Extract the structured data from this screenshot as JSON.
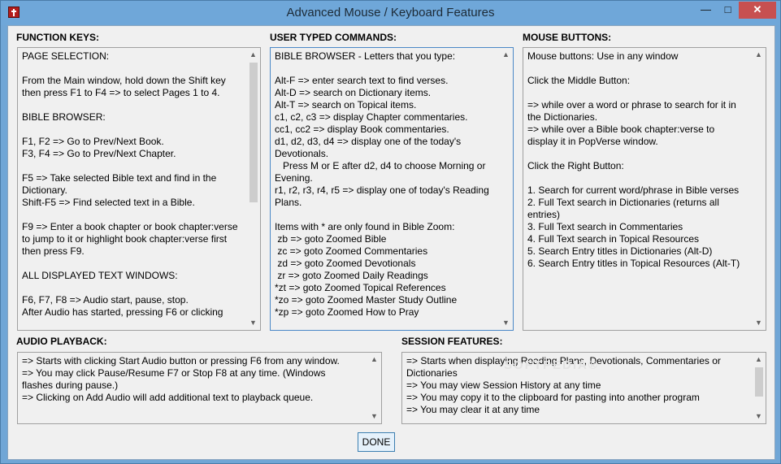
{
  "window": {
    "title": "Advanced Mouse / Keyboard Features",
    "minimize_glyph": "—",
    "maximize_glyph": "□",
    "close_glyph": "✕"
  },
  "sections": {
    "function_keys": {
      "label": "FUNCTION KEYS:",
      "text": "PAGE SELECTION:\n\nFrom the Main window, hold down the Shift key\nthen press F1 to F4 => to select Pages 1 to 4.\n\nBIBLE BROWSER:\n\nF1, F2 => Go to Prev/Next Book.\nF3, F4 => Go to Prev/Next Chapter.\n\nF5 => Take selected Bible text and find in the\nDictionary.\nShift-F5 => Find selected text in a Bible.\n\nF9 => Enter a book chapter or book chapter:verse\nto jump to it or highlight book chapter:verse first\nthen press F9.\n\nALL DISPLAYED TEXT WINDOWS:\n\nF6, F7, F8 => Audio start, pause, stop.\nAfter Audio has started, pressing F6 or clicking"
    },
    "user_typed_commands": {
      "label": "USER TYPED COMMANDS:",
      "text": "BIBLE BROWSER - Letters that you type:\n\nAlt-F => enter search text to find verses.\nAlt-D => search on Dictionary items.\nAlt-T => search on Topical items.\nc1, c2, c3 => display Chapter commentaries.\ncc1, cc2 => display Book commentaries.\nd1, d2, d3, d4 => display one of the today's\nDevotionals.\n   Press M or E after d2, d4 to choose Morning or\nEvening.\nr1, r2, r3, r4, r5 => display one of today's Reading\nPlans.\n\nItems with * are only found in Bible Zoom:\n zb => goto Zoomed Bible\n zc => goto Zoomed Commentaries\n zd => goto Zoomed Devotionals\n zr => goto Zoomed Daily Readings\n*zt => goto Zoomed Topical References\n*zo => goto Zoomed Master Study Outline\n*zp => goto Zoomed How to Pray"
    },
    "mouse_buttons": {
      "label": "MOUSE BUTTONS:",
      "text": "Mouse buttons: Use in any window\n\nClick the Middle Button:\n\n=> while over a word or phrase to search for it in\nthe Dictionaries.\n=> while over a Bible book chapter:verse to\ndisplay it in PopVerse window.\n\nClick the Right Button:\n\n1. Search for current word/phrase in Bible verses\n2. Full Text search in Dictionaries (returns all\nentries)\n3. Full Text search in Commentaries\n4. Full Text search in Topical Resources\n5. Search Entry titles in Dictionaries (Alt-D)\n6. Search Entry titles in Topical Resources (Alt-T)"
    },
    "audio_playback": {
      "label": "AUDIO PLAYBACK:",
      "text": "=> Starts with clicking Start Audio button or pressing F6 from any window.\n=> You may click Pause/Resume F7 or Stop F8 at any time. (Windows\nflashes during pause.)\n=> Clicking on Add Audio will add additional text to playback queue."
    },
    "session_features": {
      "label": "SESSION FEATURES:",
      "text": "=> Starts when displaying Reading Plans, Devotionals, Commentaries or\nDictionaries\n=> You may view Session History at any time\n=> You may copy it to the clipboard for pasting into another program\n=> You may clear it at any time"
    }
  },
  "scroll_glyphs": {
    "up": "▲",
    "down": "▼"
  },
  "done_label": "DONE",
  "watermark": "SOFTPEDIA®"
}
